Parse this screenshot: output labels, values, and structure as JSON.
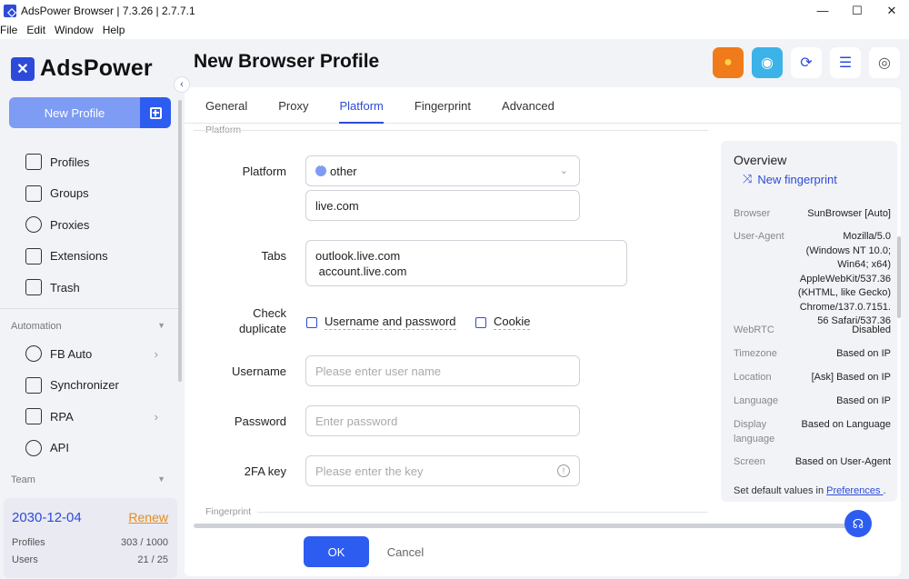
{
  "window": {
    "title": "AdsPower Browser | 7.3.26 | 2.7.7.1",
    "controls": [
      "—",
      "☐",
      "✕"
    ]
  },
  "menubar": [
    "File",
    "Edit",
    "Window",
    "Help"
  ],
  "sidebar": {
    "logo": "AdsPower",
    "new_profile": "New Profile",
    "items": [
      "Profiles",
      "Groups",
      "Proxies",
      "Extensions",
      "Trash"
    ],
    "automation_label": "Automation",
    "automation_items": [
      "FB Auto",
      "Synchronizer",
      "RPA",
      "API"
    ],
    "team_label": "Team",
    "subscription": {
      "date": "2030-12-04",
      "renew": "Renew",
      "profiles_label": "Profiles",
      "profiles_value": "303 / 1000",
      "users_label": "Users",
      "users_value": "21 / 25"
    }
  },
  "page": {
    "title": "New Browser Profile"
  },
  "tabs": [
    "General",
    "Proxy",
    "Platform",
    "Fingerprint",
    "Advanced"
  ],
  "active_tab": "Platform",
  "sections": {
    "platform": "Platform",
    "fingerprint": "Fingerprint"
  },
  "form": {
    "platform_label": "Platform",
    "platform_value": "other",
    "domain_value": "live.com",
    "tabs_label": "Tabs",
    "tabs_line1": "outlook.live.com",
    "tabs_line2": " account.live.com",
    "check_label_1": "Check",
    "check_label_2": "duplicate",
    "check_userpass": "Username and password",
    "check_cookie": "Cookie",
    "username_label": "Username",
    "username_placeholder": "Please enter user name",
    "password_label": "Password",
    "password_placeholder": "Enter password",
    "twofa_label": "2FA key",
    "twofa_placeholder": "Please enter the key"
  },
  "overview": {
    "title": "Overview",
    "new_fingerprint": "New fingerprint",
    "rows": [
      {
        "k": "Browser",
        "v": "SunBrowser [Auto]"
      },
      {
        "k": "User-Agent",
        "v": "Mozilla/5.0 (Windows NT 10.0; Win64; x64) AppleWebKit/537.36 (KHTML, like Gecko) Chrome/137.0.7151.56 Safari/537.36"
      },
      {
        "k": "WebRTC",
        "v": "Disabled"
      },
      {
        "k": "Timezone",
        "v": "Based on IP"
      },
      {
        "k": "Location",
        "v": "[Ask] Based on IP"
      },
      {
        "k": "Language",
        "v": "Based on IP"
      },
      {
        "k": "Display language",
        "v": "Based on Language"
      },
      {
        "k": "Screen Resolution",
        "v": "Based on User-Agent"
      }
    ],
    "footer_text": "Set default values in",
    "footer_link": "Preferences ",
    "footer_end": "."
  },
  "buttons": {
    "ok": "OK",
    "cancel": "Cancel"
  },
  "colors": {
    "accent": "#2d5cf0",
    "renew": "#e88c1a"
  }
}
